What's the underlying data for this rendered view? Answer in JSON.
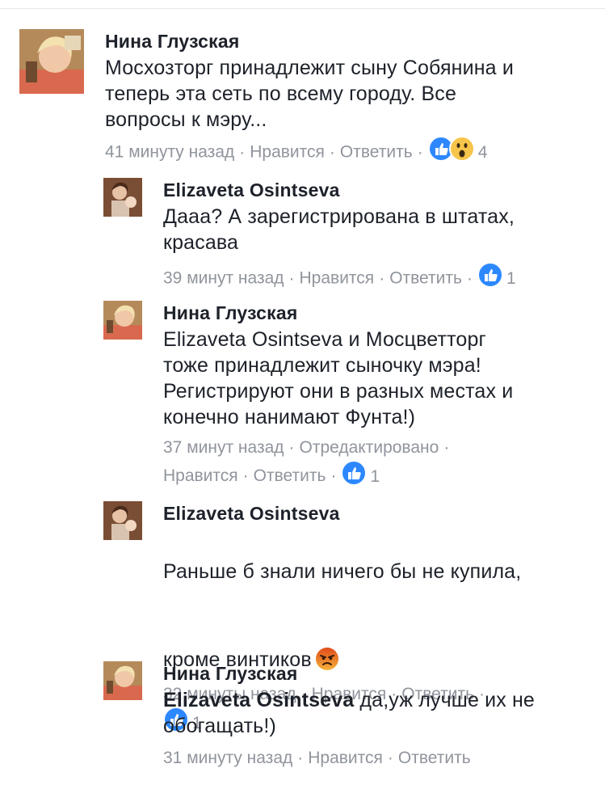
{
  "comments": [
    {
      "author": "Нина Глузская",
      "text": "Мосхозторг принадлежит сыну Собянина и\nтеперь эта сеть по всему городу. Все\nвопросы к мэру...",
      "time": "41 минуту назад",
      "like_label": "Нравится",
      "reply_label": "Ответить",
      "reactions": [
        "like",
        "wow"
      ],
      "reaction_count": "4"
    },
    {
      "author": "Elizaveta Osintseva",
      "text": "Дааа? А зарегистрирована в штатах,\nкрасава",
      "time": "39 минут назад",
      "like_label": "Нравится",
      "reply_label": "Ответить",
      "reactions": [
        "like"
      ],
      "reaction_count": "1"
    },
    {
      "author": "Нина Глузская",
      "text": "Elizaveta Osintseva и Мосцветторг\nтоже принадлежит сыночку мэра!\nРегистрируют они в разных местах и\nконечно нанимают Фунта!)",
      "time": "37 минут назад",
      "edited_label": "Отредактировано",
      "like_label": "Нравится",
      "reply_label": "Ответить",
      "reactions": [
        "like"
      ],
      "reaction_count": "1"
    },
    {
      "author": "Elizaveta Osintseva",
      "text_line1": "Раньше б знали ничего бы не купила,",
      "text_line2": "кроме винтиков",
      "emoji": "angry-face",
      "time": "32 минуты назад",
      "like_label": "Нравится",
      "reply_label": "Ответить",
      "reactions": [
        "like"
      ],
      "reaction_count": "1"
    },
    {
      "author": "Нина Глузская",
      "mention": "Elizaveta Osintseva",
      "text_after_mention": " да,уж лучше их не\nобогащать!)",
      "time": "31 минуту назад",
      "like_label": "Нравится",
      "reply_label": "Ответить"
    }
  ],
  "colors": {
    "text": "#1d2129",
    "meta": "#90949c",
    "like_blue": "#2d88ff",
    "wow_yellow": "#f7c54a",
    "angry_orange": "#e9710f"
  }
}
